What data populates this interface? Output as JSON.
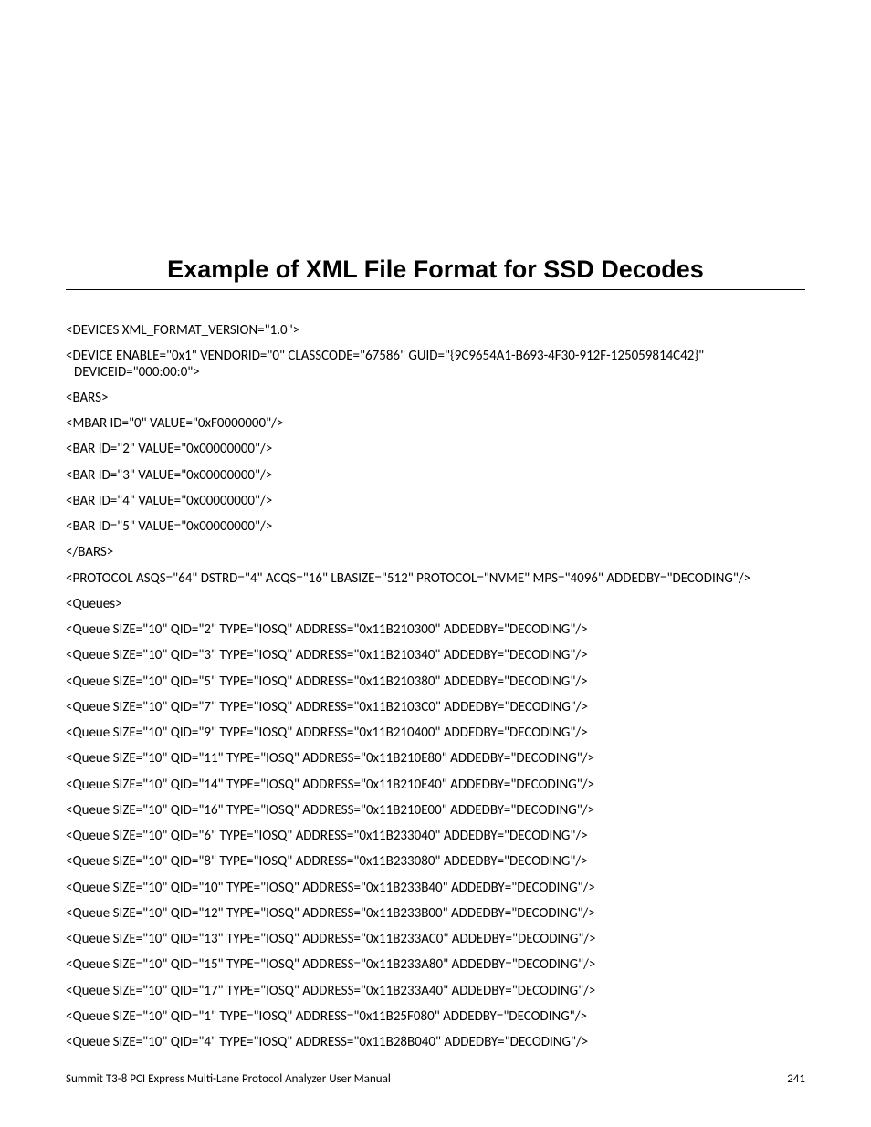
{
  "title": "Example of XML File Format for SSD Decodes",
  "lines": [
    "<DEVICES XML_FORMAT_VERSION=\"1.0\">",
    "<DEVICE ENABLE=\"0x1\" VENDORID=\"0\" CLASSCODE=\"67586\" GUID=\"{9C9654A1-B693-4F30-912F-125059814C42}\" DEVICEID=\"000:00:0\">",
    "<BARS>",
    "<MBAR ID=\"0\" VALUE=\"0xF0000000\"/>",
    "<BAR ID=\"2\" VALUE=\"0x00000000\"/>",
    "<BAR ID=\"3\" VALUE=\"0x00000000\"/>",
    "<BAR ID=\"4\" VALUE=\"0x00000000\"/>",
    "<BAR ID=\"5\" VALUE=\"0x00000000\"/>",
    "</BARS>",
    "<PROTOCOL ASQS=\"64\" DSTRD=\"4\" ACQS=\"16\" LBASIZE=\"512\" PROTOCOL=\"NVME\" MPS=\"4096\" ADDEDBY=\"DECODING\"/>",
    "<Queues>",
    "<Queue SIZE=\"10\" QID=\"2\" TYPE=\"IOSQ\" ADDRESS=\"0x11B210300\" ADDEDBY=\"DECODING\"/>",
    "<Queue SIZE=\"10\" QID=\"3\" TYPE=\"IOSQ\" ADDRESS=\"0x11B210340\" ADDEDBY=\"DECODING\"/>",
    "<Queue SIZE=\"10\" QID=\"5\" TYPE=\"IOSQ\" ADDRESS=\"0x11B210380\" ADDEDBY=\"DECODING\"/>",
    "<Queue SIZE=\"10\" QID=\"7\" TYPE=\"IOSQ\" ADDRESS=\"0x11B2103C0\" ADDEDBY=\"DECODING\"/>",
    "<Queue SIZE=\"10\" QID=\"9\" TYPE=\"IOSQ\" ADDRESS=\"0x11B210400\" ADDEDBY=\"DECODING\"/>",
    "<Queue SIZE=\"10\" QID=\"11\" TYPE=\"IOSQ\" ADDRESS=\"0x11B210E80\" ADDEDBY=\"DECODING\"/>",
    "<Queue SIZE=\"10\" QID=\"14\" TYPE=\"IOSQ\" ADDRESS=\"0x11B210E40\" ADDEDBY=\"DECODING\"/>",
    "<Queue SIZE=\"10\" QID=\"16\" TYPE=\"IOSQ\" ADDRESS=\"0x11B210E00\" ADDEDBY=\"DECODING\"/>",
    "<Queue SIZE=\"10\" QID=\"6\" TYPE=\"IOSQ\" ADDRESS=\"0x11B233040\" ADDEDBY=\"DECODING\"/>",
    "<Queue SIZE=\"10\" QID=\"8\" TYPE=\"IOSQ\" ADDRESS=\"0x11B233080\" ADDEDBY=\"DECODING\"/>",
    "<Queue SIZE=\"10\" QID=\"10\" TYPE=\"IOSQ\" ADDRESS=\"0x11B233B40\" ADDEDBY=\"DECODING\"/>",
    "<Queue SIZE=\"10\" QID=\"12\" TYPE=\"IOSQ\" ADDRESS=\"0x11B233B00\" ADDEDBY=\"DECODING\"/>",
    "<Queue SIZE=\"10\" QID=\"13\" TYPE=\"IOSQ\" ADDRESS=\"0x11B233AC0\" ADDEDBY=\"DECODING\"/>",
    "<Queue SIZE=\"10\" QID=\"15\" TYPE=\"IOSQ\" ADDRESS=\"0x11B233A80\" ADDEDBY=\"DECODING\"/>",
    "<Queue SIZE=\"10\" QID=\"17\" TYPE=\"IOSQ\" ADDRESS=\"0x11B233A40\" ADDEDBY=\"DECODING\"/>",
    "<Queue SIZE=\"10\" QID=\"1\" TYPE=\"IOSQ\" ADDRESS=\"0x11B25F080\" ADDEDBY=\"DECODING\"/>",
    "<Queue SIZE=\"10\" QID=\"4\" TYPE=\"IOSQ\" ADDRESS=\"0x11B28B040\" ADDEDBY=\"DECODING\"/>"
  ],
  "footer_left": "Summit T3-8 PCI Express Multi-Lane Protocol Analyzer User Manual",
  "footer_right": "241"
}
